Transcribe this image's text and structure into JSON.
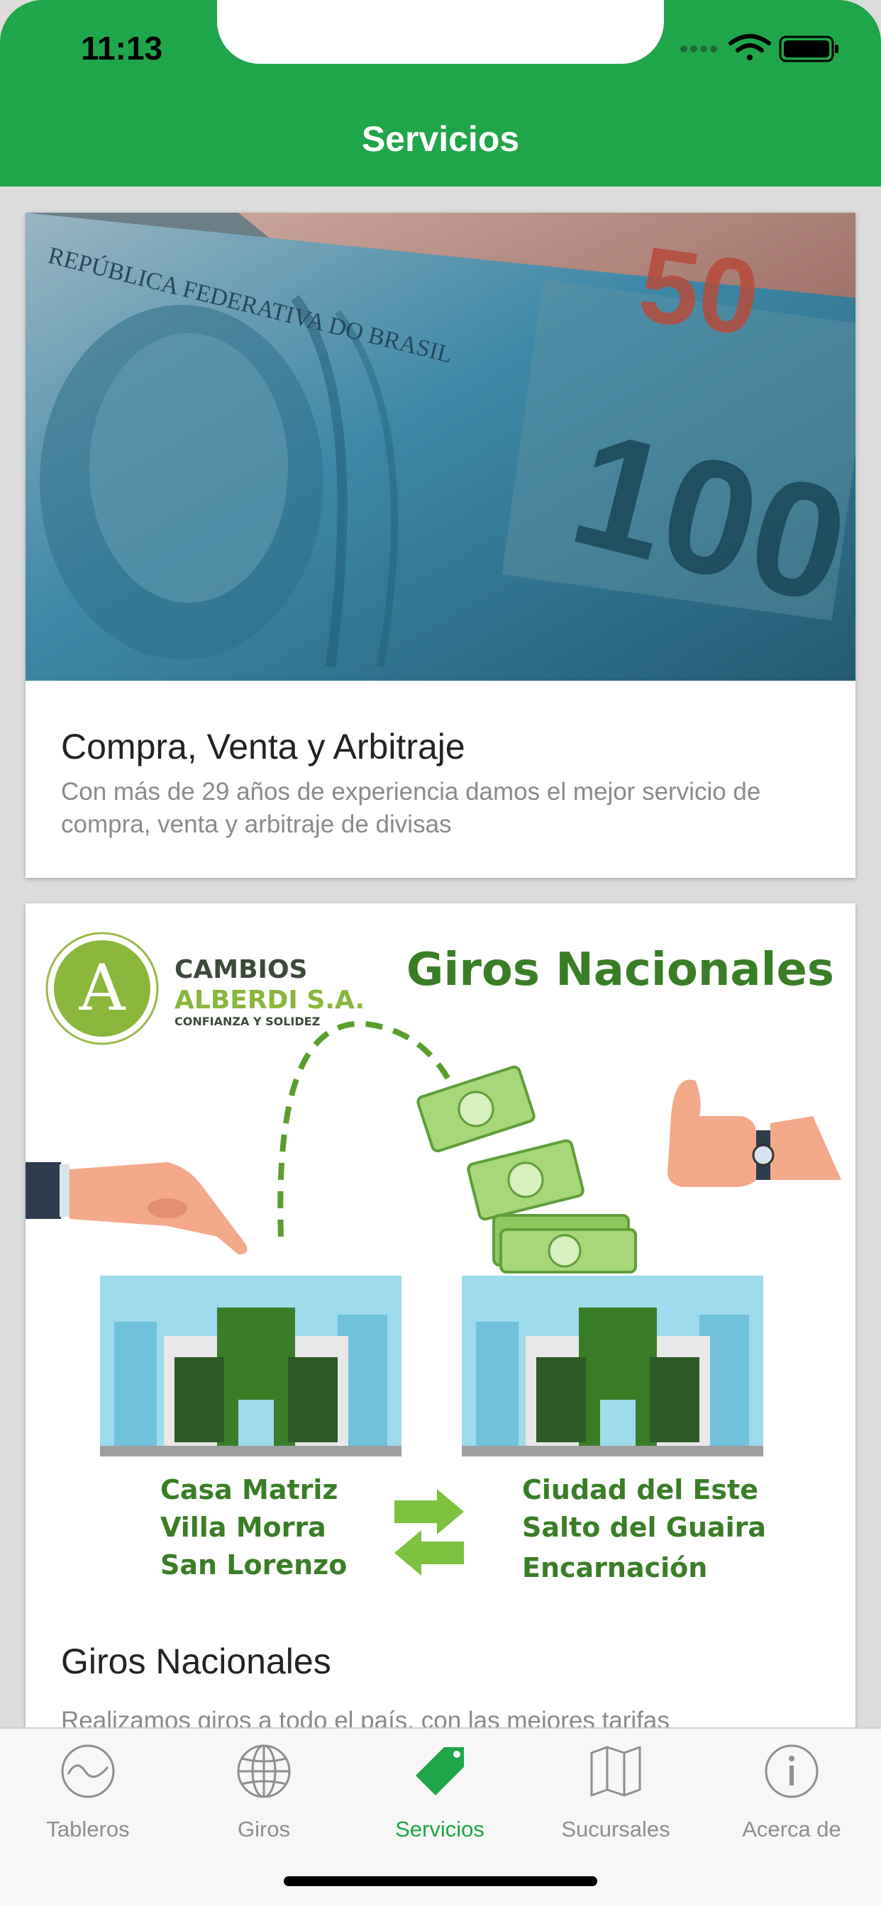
{
  "status_bar": {
    "time": "11:13"
  },
  "nav": {
    "title": "Servicios"
  },
  "colors": {
    "brand": "#1fa54a",
    "inactive": "#8e8e93"
  },
  "cards": [
    {
      "title": "Compra, Venta y Arbitraje",
      "description": "Con más de 29 años de experiencia damos el mejor servicio de compra, venta y arbitraje de divisas",
      "image": {
        "banknote_50": "50",
        "banknote_100": "100",
        "banknote_text": "REPÚBLICA FEDERATIVA DO BRASIL"
      }
    },
    {
      "title": "Giros Nacionales",
      "description": "Realizamos giros a todo el país, con las mejores tarifas",
      "image": {
        "logo_line1": "CAMBIOS",
        "logo_line2": "ALBERDI S.A.",
        "logo_tagline": "CONFIANZA Y SOLIDEZ",
        "heading": "Giros Nacionales",
        "left_locations": [
          "Casa Matriz",
          "Villa Morra",
          "San Lorenzo"
        ],
        "right_locations": [
          "Ciudad del Este",
          "Salto del Guaira",
          "Encarnación"
        ]
      }
    }
  ],
  "tab_bar": {
    "items": [
      {
        "label": "Tableros",
        "icon": "tableros-icon"
      },
      {
        "label": "Giros",
        "icon": "globe-icon"
      },
      {
        "label": "Servicios",
        "icon": "tag-icon",
        "active": true
      },
      {
        "label": "Sucursales",
        "icon": "map-icon"
      },
      {
        "label": "Acerca de",
        "icon": "info-icon"
      }
    ]
  }
}
